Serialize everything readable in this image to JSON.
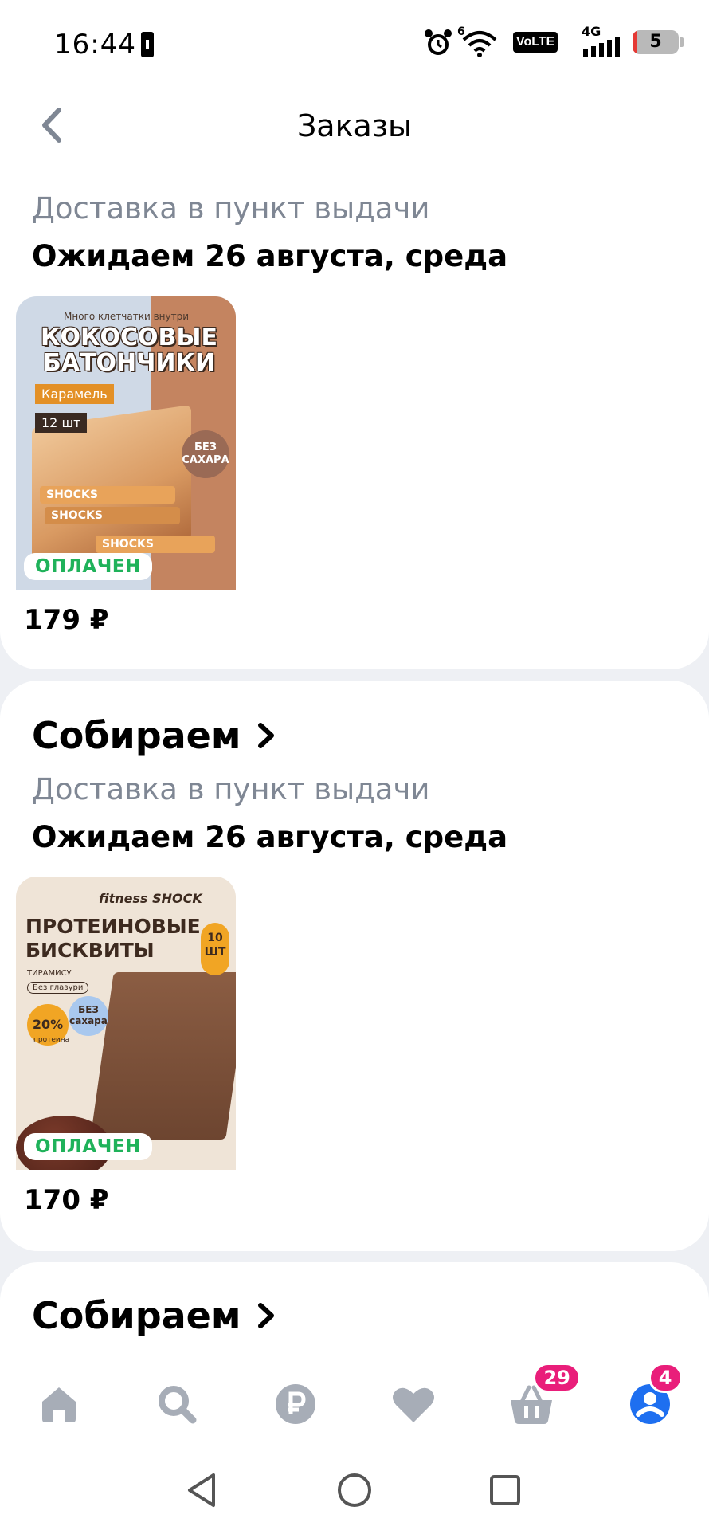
{
  "status_bar": {
    "time": "16:44",
    "signal_label": "4G",
    "volte_label": "VoLTE",
    "wifi_label": "6",
    "battery": "5"
  },
  "header": {
    "title": "Заказы",
    "back_icon": "chevron-left-icon"
  },
  "orders": [
    {
      "delivery": "Доставка в пункт выдачи",
      "expected": "Ожидаем 26 августа, среда",
      "payment_status": "ОПЛАЧЕН",
      "price": "179 ₽",
      "product_art": {
        "tag": "Много клетчатки внутри",
        "title": "КОКОСОВЫЕ БАТОНЧИКИ",
        "flavor": "Карамель",
        "qty": "12 шт",
        "badge": "БЕЗ САХАРА",
        "brand": "SHOCKS"
      }
    },
    {
      "status": "Собираем",
      "delivery": "Доставка в пункт выдачи",
      "expected": "Ожидаем 26 августа, среда",
      "payment_status": "ОПЛАЧЕН",
      "price": "170 ₽",
      "product_art": {
        "brand": "fitness SHOCK",
        "title": "ПРОТЕИНОВЫЕ БИСКВИТЫ",
        "flavor": "ТИРАМИСУ",
        "note": "Без глазури",
        "protein": "20%",
        "protein_label": "протеина",
        "badge": "БЕЗ сахара",
        "qty": "10 ШТ"
      }
    },
    {
      "status": "Собираем"
    }
  ],
  "bottom_nav": {
    "items": [
      {
        "icon": "home-icon"
      },
      {
        "icon": "search-icon"
      },
      {
        "icon": "ruble-icon"
      },
      {
        "icon": "heart-icon"
      },
      {
        "icon": "basket-icon",
        "badge": "29"
      },
      {
        "icon": "profile-icon",
        "badge": "4"
      }
    ]
  },
  "colors": {
    "accent": "#1e6ff0",
    "badge": "#e91e7a",
    "paid": "#1fb25a",
    "muted_text": "#7f8794",
    "nav_icon": "#a7adb7"
  }
}
